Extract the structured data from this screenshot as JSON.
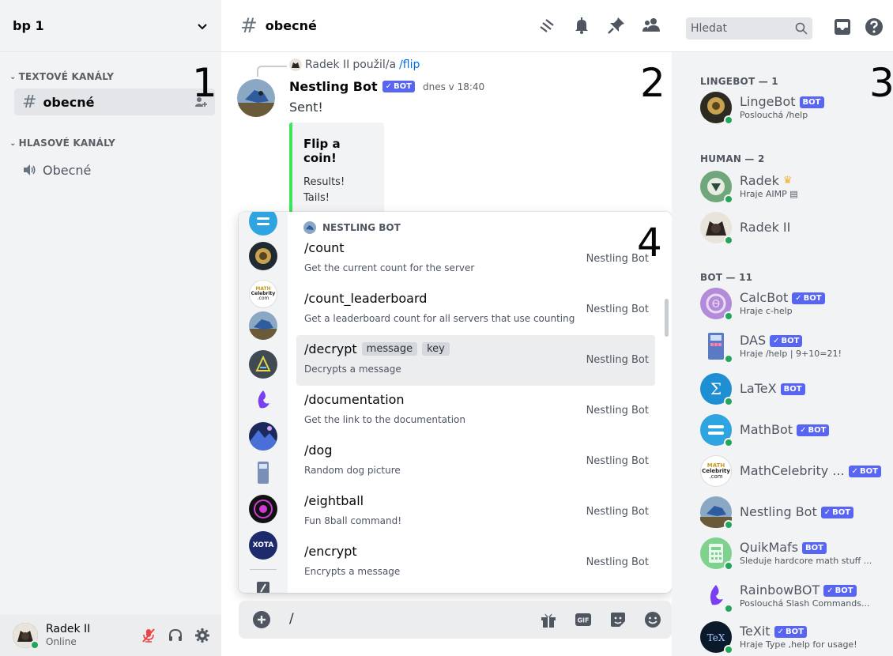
{
  "server": {
    "name": "bp 1"
  },
  "sidebar": {
    "categories": [
      {
        "label": "TEXTOVÉ KANÁLY"
      },
      {
        "label": "HLASOVÉ KANÁLY"
      }
    ],
    "text_channels": [
      {
        "name": "obecné"
      }
    ],
    "voice_channels": [
      {
        "name": "Obecné"
      }
    ]
  },
  "annotations": {
    "n1": "1",
    "n2": "2",
    "n3": "3",
    "n4": "4"
  },
  "user": {
    "name": "Radek II",
    "status": "Online"
  },
  "topbar": {
    "channel": "obecné",
    "search_placeholder": "Hledat"
  },
  "message": {
    "reply_user": "Radek II",
    "reply_verb": "použil/a",
    "reply_command": "/flip",
    "author": "Nestling Bot",
    "bot_tag": "BOT",
    "time": "dnes v 18:40",
    "text": "Sent!",
    "embed": {
      "title": "Flip a coin!",
      "description": "Results!\nTails!"
    }
  },
  "autocomplete": {
    "header": "NESTLING BOT",
    "commands": [
      {
        "name": "/count",
        "options": [],
        "desc": "Get the current count for the server",
        "source": "Nestling Bot"
      },
      {
        "name": "/count_leaderboard",
        "options": [],
        "desc": "Get a leaderboard count for all servers that use counting",
        "source": "Nestling Bot"
      },
      {
        "name": "/decrypt",
        "options": [
          "message",
          "key"
        ],
        "desc": "Decrypts a message",
        "source": "Nestling Bot"
      },
      {
        "name": "/documentation",
        "options": [],
        "desc": "Get the link to the documentation",
        "source": "Nestling Bot"
      },
      {
        "name": "/dog",
        "options": [],
        "desc": "Random dog picture",
        "source": "Nestling Bot"
      },
      {
        "name": "/eightball",
        "options": [],
        "desc": "Fun 8ball command!",
        "source": "Nestling Bot"
      },
      {
        "name": "/encrypt",
        "options": [],
        "desc": "Encrypts a message",
        "source": "Nestling Bot"
      }
    ],
    "highlighted_index": 2,
    "rail_texts": {
      "mathcelebrity_line1": "MATH",
      "mathcelebrity_line2": "Celebrity",
      "mathcelebrity_line3": ".com",
      "xota": "XOTA"
    }
  },
  "composer": {
    "value": "/",
    "gif_label": "GIF"
  },
  "members": {
    "groups": [
      {
        "label": "LINGEBOT — 1"
      },
      {
        "label": "HUMAN — 2"
      },
      {
        "label": "BOT — 11"
      }
    ],
    "list": [
      {
        "name": "LingeBot",
        "activity": "Poslouchá /help",
        "tag": "BOT",
        "verified": false
      },
      {
        "name": "Radek",
        "activity": "Hraje AIMP",
        "tag": "",
        "owner": true
      },
      {
        "name": "Radek II",
        "activity": "",
        "tag": ""
      },
      {
        "name": "CalcBot",
        "activity": "Hraje c-help",
        "tag": "BOT",
        "verified": true
      },
      {
        "name": "DAS",
        "activity": "Hraje /help | 9+10=21!",
        "tag": "BOT",
        "verified": true
      },
      {
        "name": "LaTeX",
        "activity": "",
        "tag": "BOT",
        "verified": false
      },
      {
        "name": "MathBot",
        "activity": "",
        "tag": "BOT",
        "verified": true
      },
      {
        "name": "MathCelebrity ...",
        "activity": "",
        "tag": "BOT",
        "verified": true
      },
      {
        "name": "Nestling Bot",
        "activity": "",
        "tag": "BOT",
        "verified": true
      },
      {
        "name": "QuikMafs",
        "activity": "Sleduje hardcore math stuff ...",
        "tag": "BOT",
        "verified": false
      },
      {
        "name": "RainbowBOT",
        "activity": "Poslouchá Slash Commands...",
        "tag": "BOT",
        "verified": true
      },
      {
        "name": "TeXit",
        "activity": "Hraje Type ,help for usage!",
        "tag": "BOT",
        "verified": true
      }
    ]
  },
  "colors": {
    "accent": "#5865f2",
    "online": "#23a55a",
    "embed_bar": "#3ce65c",
    "link": "#006ce7"
  }
}
